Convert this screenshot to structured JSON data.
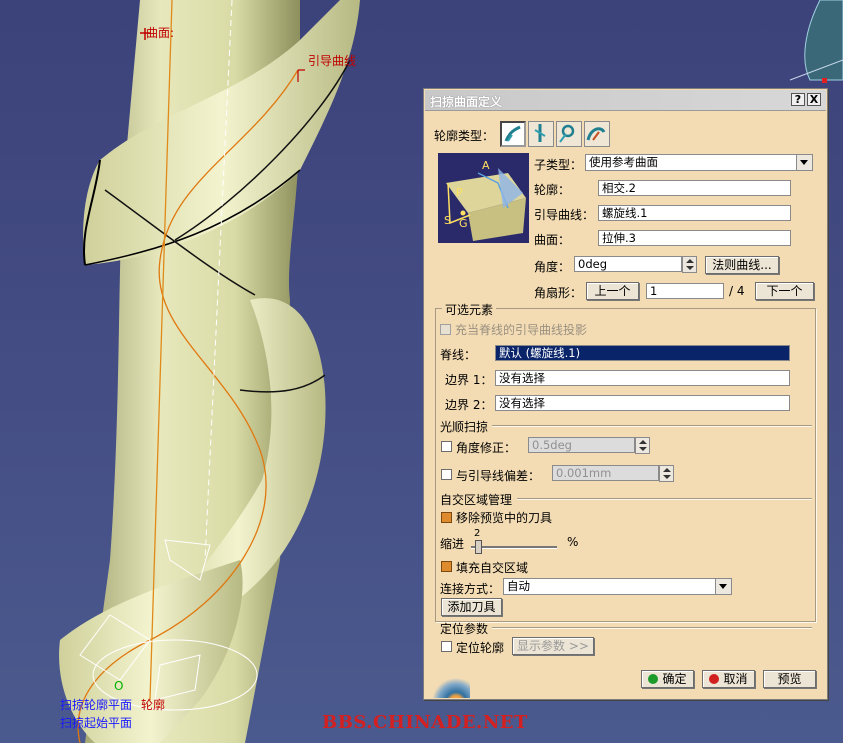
{
  "viewport": {
    "label_surface": "曲面:",
    "label_guide": "引导曲线",
    "label_profile_plane": "扫掠轮廓平面",
    "label_profile": "轮廓",
    "label_start_plane": "扫掠起始平面",
    "axis_o": "O",
    "watermark": "BBS.CHINADE.NET"
  },
  "dialog": {
    "title": "扫掠曲面定义",
    "help_label": "?",
    "close_label": "X",
    "profile_type_label": "轮廓类型：",
    "profile_type_icons": [
      "explicit-profile-icon",
      "line-profile-icon",
      "circle-profile-icon",
      "conic-profile-icon"
    ],
    "subtype_label": "子类型：",
    "subtype_value": "使用参考曲面",
    "profile_label": "轮廓：",
    "profile_value": "相交.2",
    "guide_label": "引导曲线：",
    "guide_value": "螺旋线.1",
    "surface_label": "曲面：",
    "surface_value": "拉伸.3",
    "angle_label": "角度：",
    "angle_value": "0deg",
    "law_button": "法则曲线...",
    "sector_label": "角扇形：",
    "prev_button": "上一个",
    "sector_value": "1",
    "sector_total": "/ 4",
    "next_button": "下一个",
    "optional_section": "可选元素",
    "project_checkbox": "充当脊线的引导曲线投影",
    "spine_label": "脊线：",
    "spine_value": "默认 (螺旋线.1)",
    "border1_label": "边界 1：",
    "border1_value": "没有选择",
    "border2_label": "边界 2：",
    "border2_value": "没有选择",
    "smooth_section": "光顺扫掠",
    "angle_correction_label": "角度修正：",
    "angle_correction_value": "0.5deg",
    "deviation_label": "与引导线偏差：",
    "deviation_value": "0.001mm",
    "self_intersect_section": "自交区域管理",
    "remove_tools_label": "移除预览中的刀具",
    "retract_label": "缩进",
    "retract_value": "2",
    "retract_unit": "%",
    "fill_label": "填充自交区域",
    "connect_label": "连接方式：",
    "connect_value": "自动",
    "add_tool_button": "添加刀具",
    "position_section": "定位参数",
    "position_profile_label": "定位轮廓",
    "show_params_button": "显示参数 >>",
    "ok_button": "确定",
    "cancel_button": "取消",
    "preview_button": "预览",
    "preview_img_labels": {
      "a": "A",
      "p": "P",
      "s": "S",
      "g": "G"
    }
  }
}
